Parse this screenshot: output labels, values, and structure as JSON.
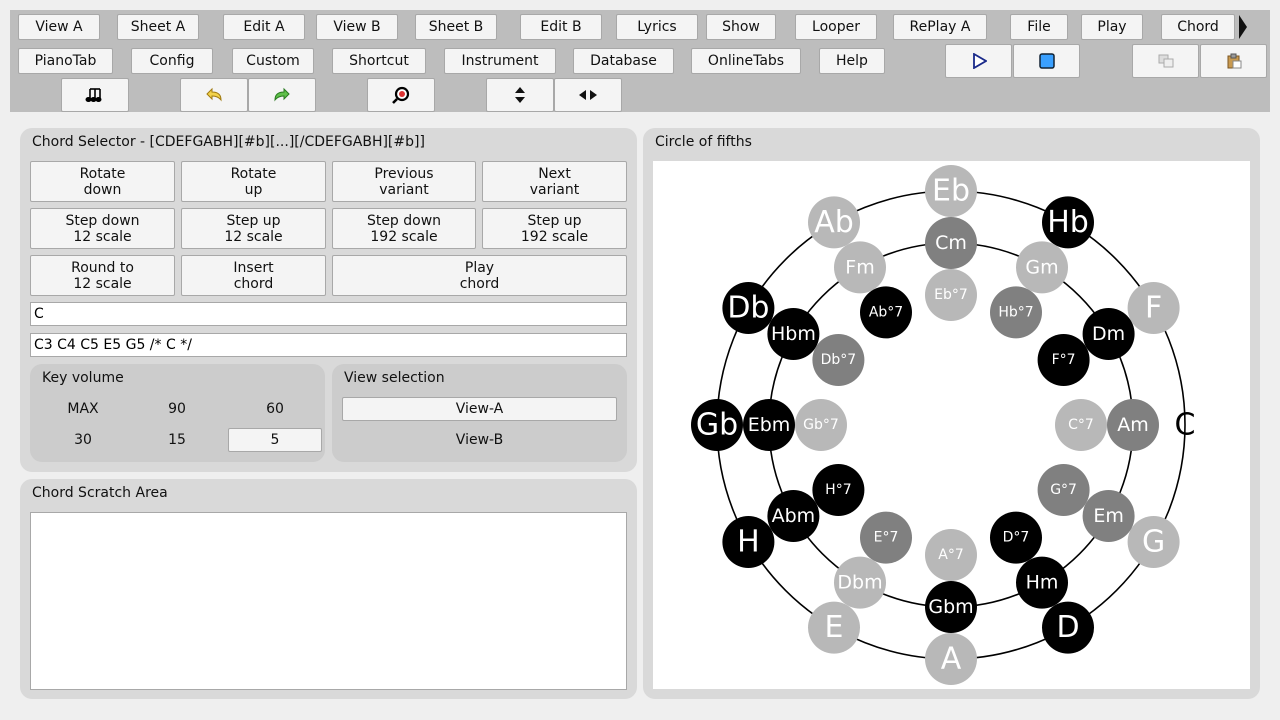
{
  "toolbar": {
    "row1": [
      "View A",
      "Sheet A",
      "Edit A",
      "View B",
      "Sheet B",
      "Edit B",
      "Lyrics",
      "Show",
      "Looper",
      "RePlay A",
      "File",
      "Play",
      "Chord"
    ],
    "row2": [
      "PianoTab",
      "Config",
      "Custom",
      "Shortcut",
      "Instrument",
      "Database",
      "OnlineTabs",
      "Help"
    ]
  },
  "chord_selector": {
    "title": "Chord Selector - [CDEFGABH][#b][...][/CDEFGABH][#b]]",
    "buttons": [
      {
        "l1": "Rotate",
        "l2": "down"
      },
      {
        "l1": "Rotate",
        "l2": "up"
      },
      {
        "l1": "Previous",
        "l2": "variant"
      },
      {
        "l1": "Next",
        "l2": "variant"
      },
      {
        "l1": "Step down",
        "l2": "12 scale"
      },
      {
        "l1": "Step up",
        "l2": "12 scale"
      },
      {
        "l1": "Step down",
        "l2": "192 scale"
      },
      {
        "l1": "Step up",
        "l2": "192 scale"
      },
      {
        "l1": "Round to",
        "l2": "12 scale"
      },
      {
        "l1": "Insert",
        "l2": "chord"
      },
      {
        "l1": "Play",
        "l2": "chord"
      }
    ],
    "chord_input": "C",
    "notes_input": "C3 C4 C5 E5 G5 /* C */"
  },
  "key_volume": {
    "title": "Key volume",
    "values": [
      "MAX",
      "90",
      "60",
      "30",
      "15",
      "5"
    ],
    "selected": "5"
  },
  "view_selection": {
    "title": "View selection",
    "options": [
      "View-A",
      "View-B"
    ],
    "selected": "View-A"
  },
  "scratch": {
    "title": "Chord Scratch Area"
  },
  "circle": {
    "title": "Circle of fifths",
    "colors": {
      "black": "#000000",
      "dark": "#808080",
      "light": "#b8b8b8",
      "ring": "#000000",
      "bg": "#ffffff"
    },
    "outer": [
      {
        "label": "C",
        "shade": "none"
      },
      {
        "label": "G",
        "shade": "light"
      },
      {
        "label": "D",
        "shade": "black"
      },
      {
        "label": "A",
        "shade": "light"
      },
      {
        "label": "E",
        "shade": "light"
      },
      {
        "label": "H",
        "shade": "black"
      },
      {
        "label": "Gb",
        "shade": "black"
      },
      {
        "label": "Db",
        "shade": "black"
      },
      {
        "label": "Ab",
        "shade": "light"
      },
      {
        "label": "Eb",
        "shade": "light"
      },
      {
        "label": "Hb",
        "shade": "black"
      },
      {
        "label": "F",
        "shade": "light"
      }
    ],
    "middle": [
      {
        "label": "Am",
        "shade": "dark"
      },
      {
        "label": "Em",
        "shade": "dark"
      },
      {
        "label": "Hm",
        "shade": "black"
      },
      {
        "label": "Gbm",
        "shade": "black"
      },
      {
        "label": "Dbm",
        "shade": "light"
      },
      {
        "label": "Abm",
        "shade": "black"
      },
      {
        "label": "Ebm",
        "shade": "black"
      },
      {
        "label": "Hbm",
        "shade": "black"
      },
      {
        "label": "Fm",
        "shade": "light"
      },
      {
        "label": "Cm",
        "shade": "dark"
      },
      {
        "label": "Gm",
        "shade": "light"
      },
      {
        "label": "Dm",
        "shade": "black"
      }
    ],
    "inner": [
      {
        "label": "C°7",
        "shade": "light"
      },
      {
        "label": "G°7",
        "shade": "dark"
      },
      {
        "label": "D°7",
        "shade": "black"
      },
      {
        "label": "A°7",
        "shade": "light"
      },
      {
        "label": "E°7",
        "shade": "dark"
      },
      {
        "label": "H°7",
        "shade": "black"
      },
      {
        "label": "Gb°7",
        "shade": "light"
      },
      {
        "label": "Db°7",
        "shade": "dark"
      },
      {
        "label": "Ab°7",
        "shade": "black"
      },
      {
        "label": "Eb°7",
        "shade": "light"
      },
      {
        "label": "Hb°7",
        "shade": "dark"
      },
      {
        "label": "F°7",
        "shade": "black"
      }
    ]
  }
}
